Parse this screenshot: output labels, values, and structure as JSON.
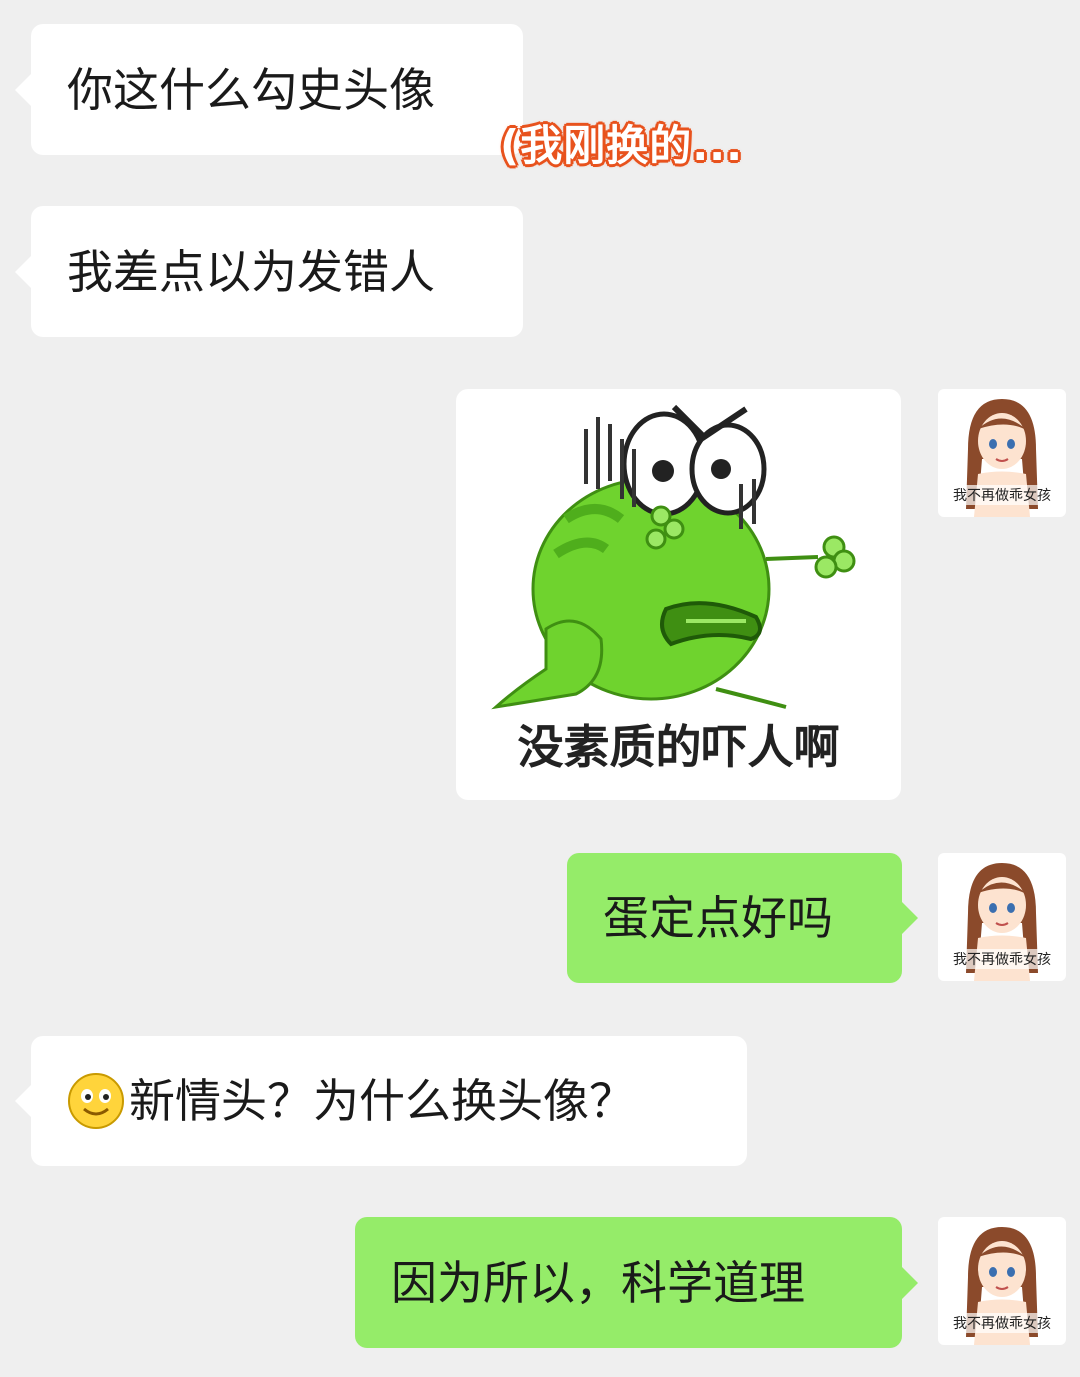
{
  "messages": [
    {
      "side": "left",
      "text": "你这什么勾史头像"
    },
    {
      "side": "left",
      "text": "我差点以为发错人"
    },
    {
      "side": "right",
      "type": "sticker",
      "caption": "没素质的吓人啊",
      "sticker_icon": "angry-frog-sticker"
    },
    {
      "side": "right",
      "text": "蛋定点好吗"
    },
    {
      "side": "left",
      "emoji": "smile-emoji-icon",
      "text": "新情头？为什么换头像？"
    },
    {
      "side": "right",
      "text": "因为所以，科学道理"
    }
  ],
  "annotation": "(我刚换的...",
  "avatar": {
    "caption": "我不再做乖女孩",
    "icon": "anime-girl-avatar-icon"
  },
  "colors": {
    "background": "#efefef",
    "left_bubble": "#ffffff",
    "right_bubble": "#95ec69",
    "annotation_outline": "#e8531e",
    "frog_green": "#6fd32e"
  }
}
